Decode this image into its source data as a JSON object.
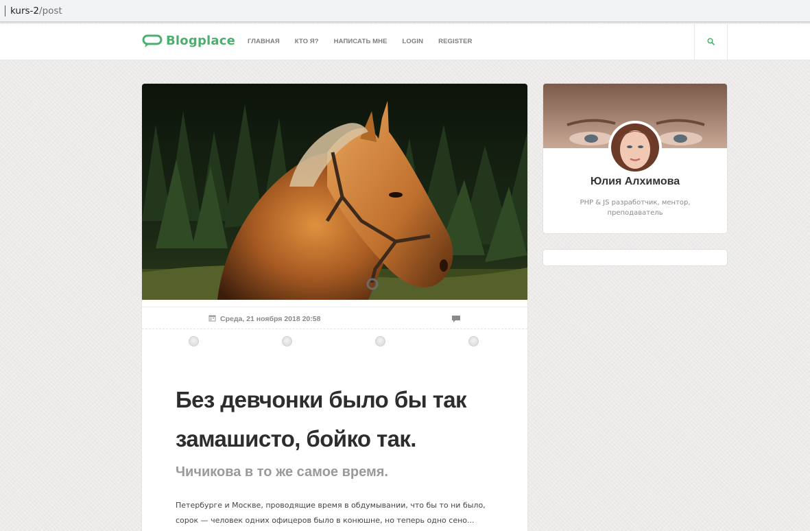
{
  "browser": {
    "url_host": "kurs-2",
    "url_path": "/post"
  },
  "header": {
    "logo_text": "Blogplace",
    "nav": [
      "ГЛАВНАЯ",
      "КТО Я?",
      "НАПИСАТЬ МНЕ",
      "LOGIN",
      "REGISTER"
    ],
    "accent_color": "#4caf6e"
  },
  "post": {
    "image": "horse-photo",
    "date": "Среда, 21 ноября 2018 20:58",
    "title": "Без девчонки было бы так замашисто, бойко так.",
    "subtitle": "Чичикова в то же самое время.",
    "body": "Петербурге и Москве, проводящие время в обдумывании, что бы то ни было, сорок — человек одних офицеров было в конюшне, но теперь одно сено... насилу дотащился до комнаты..."
  },
  "author": {
    "name": "Юлия Алхимова",
    "bio": "PHP & JS разработчик, ментор, преподаватель"
  },
  "icons": {
    "search": "search-icon",
    "calendar": "calendar-icon",
    "comment": "comment-icon",
    "logo": "speech-bubble-icon"
  }
}
